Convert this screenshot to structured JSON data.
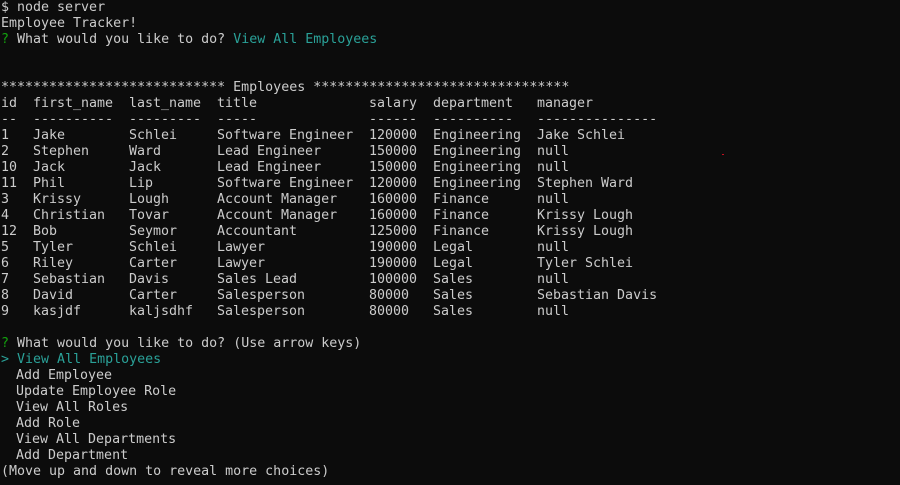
{
  "terminal": {
    "command": "$ node server",
    "banner": "Employee Tracker!",
    "prompt1": {
      "marker": "?",
      "question": "What would you like to do?",
      "answer": "View All Employees"
    },
    "table_heading": "**************************** Employees ********************************",
    "columns": [
      "id",
      "first_name",
      "last_name",
      "title",
      "salary",
      "department",
      "manager"
    ],
    "separators": [
      "--",
      "----------",
      "---------",
      "-----",
      "------",
      "----------",
      "---------------"
    ],
    "rows": [
      [
        "1",
        "Jake",
        "Schlei",
        "Software Engineer",
        "120000",
        "Engineering",
        "Jake Schlei"
      ],
      [
        "2",
        "Stephen",
        "Ward",
        "Lead Engineer",
        "150000",
        "Engineering",
        "null"
      ],
      [
        "10",
        "Jack",
        "Jack",
        "Lead Engineer",
        "150000",
        "Engineering",
        "null"
      ],
      [
        "11",
        "Phil",
        "Lip",
        "Software Engineer",
        "120000",
        "Engineering",
        "Stephen Ward"
      ],
      [
        "3",
        "Krissy",
        "Lough",
        "Account Manager",
        "160000",
        "Finance",
        "null"
      ],
      [
        "4",
        "Christian",
        "Tovar",
        "Account Manager",
        "160000",
        "Finance",
        "Krissy Lough"
      ],
      [
        "12",
        "Bob",
        "Seymor",
        "Accountant",
        "125000",
        "Finance",
        "Krissy Lough"
      ],
      [
        "5",
        "Tyler",
        "Schlei",
        "Lawyer",
        "190000",
        "Legal",
        "null"
      ],
      [
        "6",
        "Riley",
        "Carter",
        "Lawyer",
        "190000",
        "Legal",
        "Tyler Schlei"
      ],
      [
        "7",
        "Sebastian",
        "Davis",
        "Sales Lead",
        "100000",
        "Sales",
        "null"
      ],
      [
        "8",
        "David",
        "Carter",
        "Salesperson",
        "80000",
        "Sales",
        "Sebastian Davis"
      ],
      [
        "9",
        "kasjdf",
        "kaljsdhf",
        "Salesperson",
        "80000",
        "Sales",
        "null"
      ]
    ],
    "prompt2": {
      "marker": "?",
      "question": "What would you like to do?",
      "hint": "(Use arrow keys)"
    },
    "menu": {
      "pointer": ">",
      "selected_index": 0,
      "items": [
        "View All Employees",
        "Add Employee",
        "Update Employee Role",
        "View All Roles",
        "Add Role",
        "View All Departments",
        "Add Department"
      ],
      "footer": "(Move up and down to reveal more choices)"
    },
    "colors": {
      "background": "#0c0c0c",
      "foreground": "#cccccc",
      "prompt_marker": "#13a10e",
      "answer": "#2aa198"
    }
  }
}
